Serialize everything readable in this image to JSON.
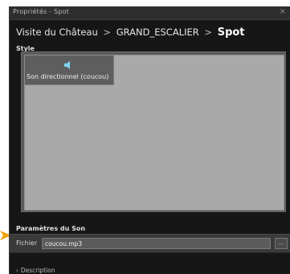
{
  "window": {
    "title": "Propriétés - Spot",
    "close_symbol": "×"
  },
  "breadcrumb": {
    "root": "Visite du Château",
    "separator": ">",
    "parent": "GRAND_ESCALIER",
    "current": "Spot"
  },
  "style_section": {
    "label": "Style",
    "items": [
      {
        "label": "Son directionnel (coucou)",
        "icon": "speaker-icon",
        "selected": true
      }
    ]
  },
  "sound_section": {
    "label": "Paramètres du Son",
    "file_label": "Fichier",
    "file_value": "coucou.mp3",
    "browse_label": "..."
  },
  "description": {
    "label": "Description",
    "collapsed": true
  },
  "colors": {
    "window_bg": "#161616",
    "panel_bg": "#a9a9a9",
    "accent_arrow": "#f0a000",
    "speaker_icon": "#7fd4f0"
  }
}
